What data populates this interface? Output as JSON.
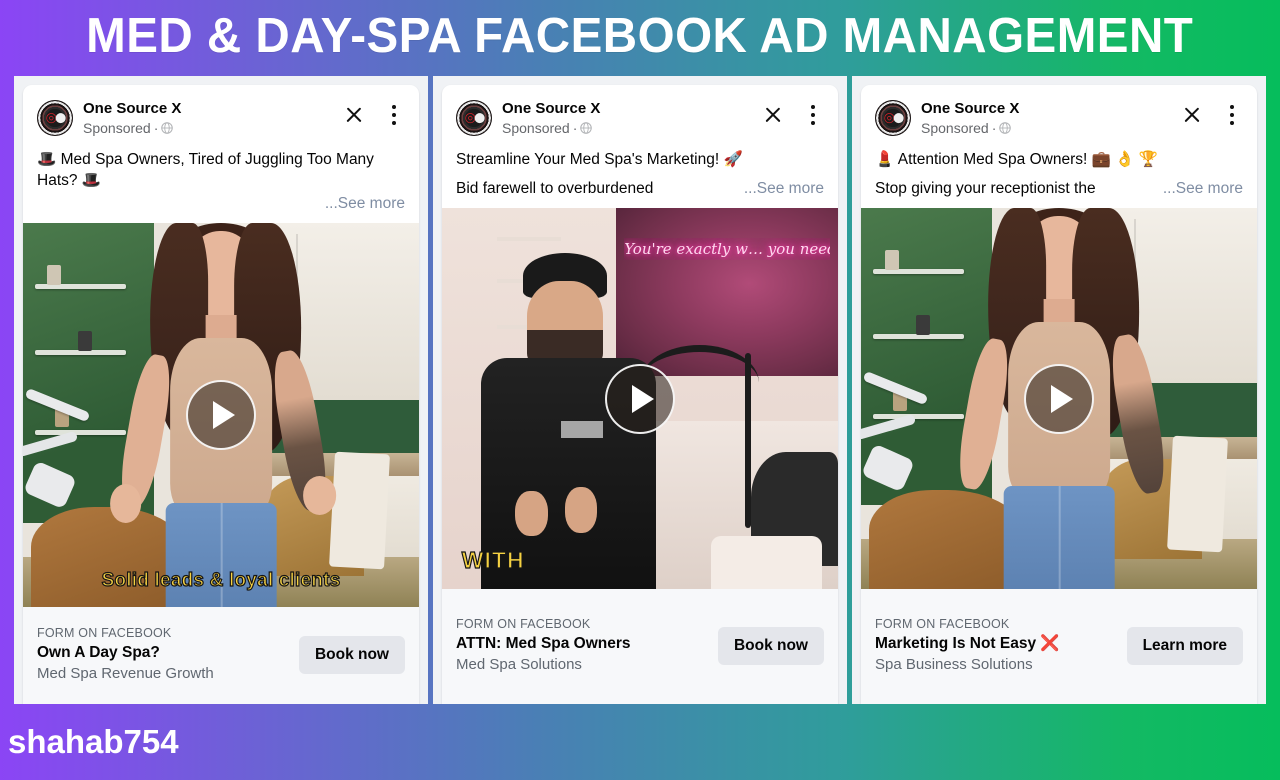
{
  "header": {
    "title": "MED & DAY-SPA  FACEBOOK AD MANAGEMENT",
    "gradient_start": "#8b45f5",
    "gradient_mid": "#3f85ad",
    "gradient_end": "#06bd5c"
  },
  "footer": {
    "username": "shahab754"
  },
  "ads": [
    {
      "page_name": "One Source X",
      "sponsored_label": "Sponsored",
      "sponsored_separator": "·",
      "globe_icon": "globe-icon",
      "close_icon": "close-icon",
      "menu_icon": "more-options-icon",
      "primary_text": "🎩 Med Spa Owners, Tired of Juggling Too Many Hats? 🎩",
      "see_more": "...See more",
      "video_caption": "Solid leads & loyal clients",
      "play_icon": "play-button-icon",
      "cta_kicker": "FORM ON FACEBOOK",
      "cta_title": "Own A Day Spa?",
      "cta_subtitle": "Med Spa Revenue Growth",
      "cta_button": "Book now"
    },
    {
      "page_name": "One Source X",
      "sponsored_label": "Sponsored",
      "sponsored_separator": "·",
      "globe_icon": "globe-icon",
      "close_icon": "close-icon",
      "menu_icon": "more-options-icon",
      "primary_text": "Streamline Your Med Spa's Marketing! 🚀",
      "primary_text_second_line": "Bid farewell to overburdened",
      "see_more": "...See more",
      "video_caption": "WITH",
      "neon_sign_text": "You're exactly w… you need to b…",
      "play_icon": "play-button-icon",
      "cta_kicker": "FORM ON FACEBOOK",
      "cta_title": "ATTN: Med Spa Owners",
      "cta_subtitle": "Med Spa Solutions",
      "cta_button": "Book now"
    },
    {
      "page_name": "One Source X",
      "sponsored_label": "Sponsored",
      "sponsored_separator": "·",
      "globe_icon": "globe-icon",
      "close_icon": "close-icon",
      "menu_icon": "more-options-icon",
      "primary_text": "💄 Attention Med Spa Owners! 💼 👌 🏆",
      "primary_text_second_line": "Stop giving your receptionist the",
      "see_more": "...See more",
      "video_caption": "",
      "play_icon": "play-button-icon",
      "cta_kicker": "FORM ON FACEBOOK",
      "cta_title": "Marketing Is Not Easy ❌",
      "cta_subtitle": "Spa Business Solutions",
      "cta_button": "Learn more"
    }
  ]
}
